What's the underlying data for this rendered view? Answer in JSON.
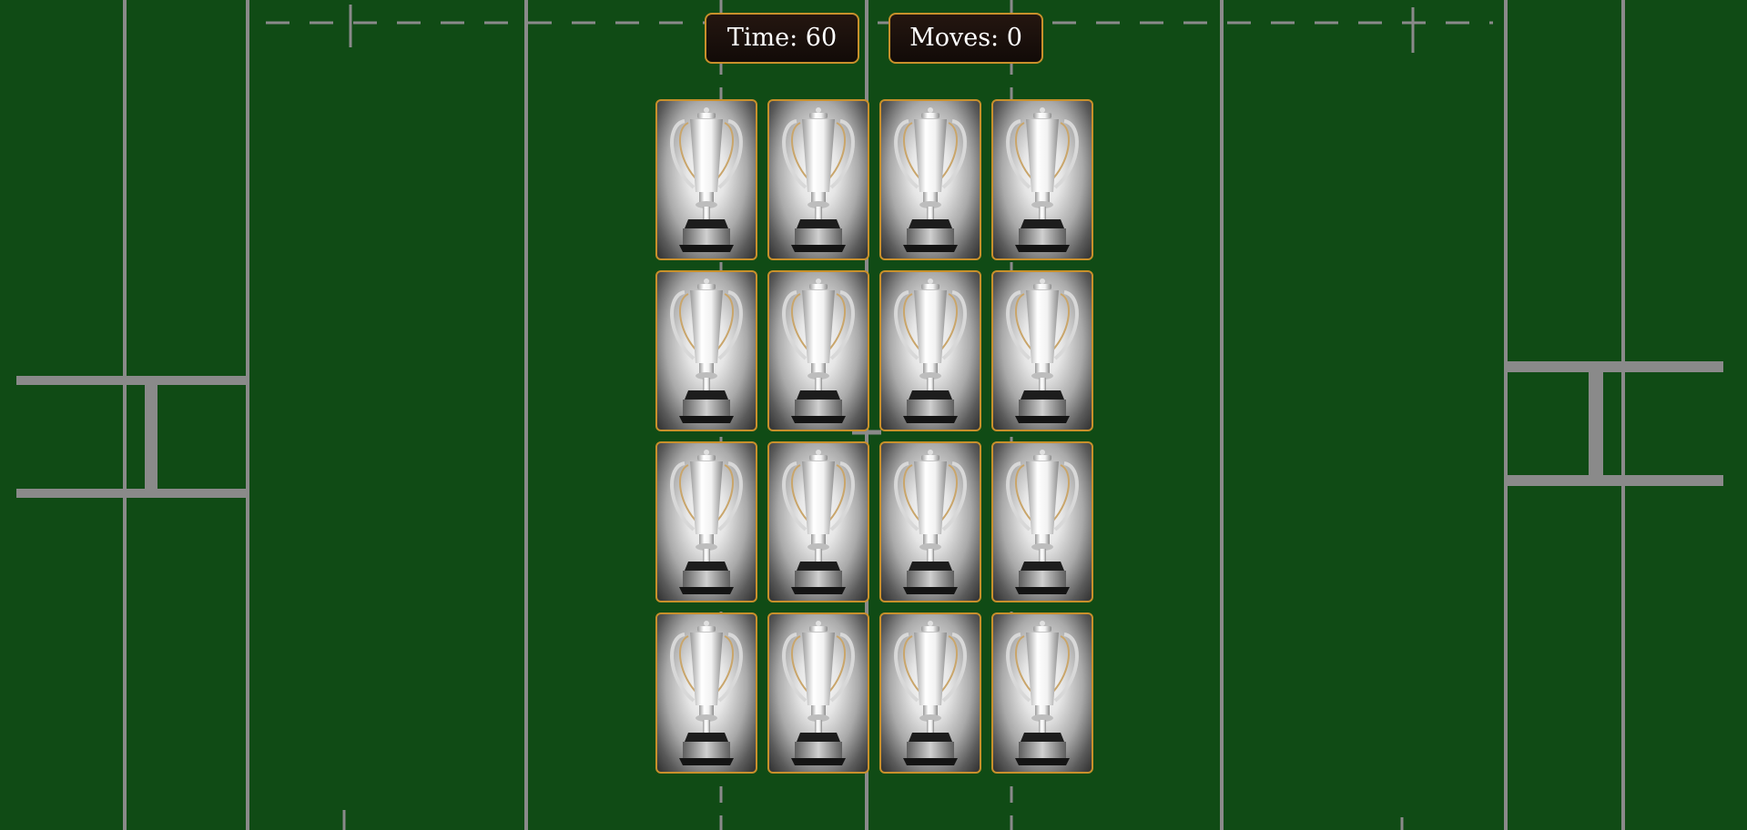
{
  "hud": {
    "time_label": "Time: 60",
    "moves_label": "Moves: 0"
  },
  "board": {
    "rows": 4,
    "columns": 4,
    "card_back_icon": "trophy-icon",
    "cards": [
      {
        "state": "face-down"
      },
      {
        "state": "face-down"
      },
      {
        "state": "face-down"
      },
      {
        "state": "face-down"
      },
      {
        "state": "face-down"
      },
      {
        "state": "face-down"
      },
      {
        "state": "face-down"
      },
      {
        "state": "face-down"
      },
      {
        "state": "face-down"
      },
      {
        "state": "face-down"
      },
      {
        "state": "face-down"
      },
      {
        "state": "face-down"
      },
      {
        "state": "face-down"
      },
      {
        "state": "face-down"
      },
      {
        "state": "face-down"
      },
      {
        "state": "face-down"
      }
    ]
  },
  "colors": {
    "pitch": "#104b15",
    "pitch_lines": "#8a8a8a",
    "card_border": "#c8902b",
    "hud_background": "#1a100c",
    "hud_text": "#ffffff"
  }
}
